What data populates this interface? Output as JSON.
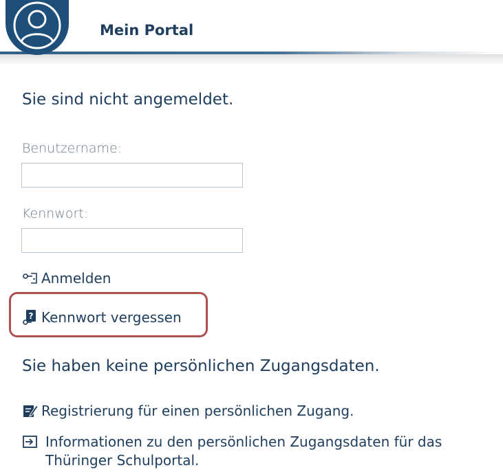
{
  "header": {
    "title": "Mein Portal"
  },
  "login": {
    "status": "Sie sind nicht angemeldet.",
    "username_label": "Benutzername:",
    "username_value": "",
    "password_label": "Kennwort:",
    "password_value": "",
    "login_label": "Anmelden",
    "forgot_label": "Kennwort vergessen"
  },
  "no_access": {
    "heading": "Sie haben keine persönlichen Zugangsdaten.",
    "register_label": "Registrierung für einen persönlichen Zugang.",
    "info_line1": "Informationen zu den persönlichen Zugangsdaten für das",
    "info_line2": "Thüringer Schulportal."
  },
  "colors": {
    "brand": "#1e4f7a",
    "text": "#1f3d5c",
    "highlight": "#b04f4f"
  },
  "icons": {
    "avatar": "user-circle-icon",
    "login": "key-login-icon",
    "forgot": "key-question-icon",
    "register": "edit-form-icon",
    "info": "enter-arrow-icon"
  }
}
